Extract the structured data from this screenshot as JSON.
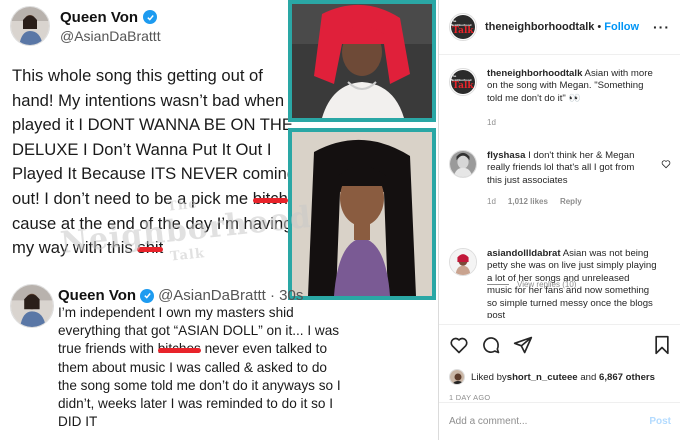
{
  "post_image": {
    "tweet1": {
      "name": "Queen Von",
      "handle": "@AsianDaBrattt",
      "text_a": "This whole song this getting out of hand! My intentions wasn’t bad when I played it I DONT WANNA BE ON THE DELUXE I Don’t Wanna Put It Out I Played It Because ITS NEVER coming out! I don’t need to be a pick me ",
      "censored_1": "bitch",
      "text_b": " cause at the end of the day I’m having my way with this ",
      "censored_2": "shit"
    },
    "watermark": {
      "small": "The",
      "big": "Neighborhood",
      "sub": "Talk"
    },
    "tweet2": {
      "name": "Queen Von",
      "handle_time": "@AsianDaBrattt · 30s",
      "text_a": "I’m independent I own my masters shid everything that got “ASIAN DOLL” on it... I was true friends with ",
      "censored": "bitches",
      "text_b": " never even talked to them about music I was called & asked to do the song some told me don’t do it anyways so I didn’t, weeks later I was reminded to do it so I DID IT"
    }
  },
  "sidebar": {
    "header": {
      "username": "theneighborhoodtalk",
      "separator": "•",
      "follow_label": "Follow",
      "more_label": "···",
      "logo_text_top": "The Neighborhood",
      "logo_text_bottom": "Talk"
    },
    "caption": {
      "username": "theneighborhoodtalk",
      "text": "Asian with more on the song with Megan. \"Something told me don't do it\" 👀",
      "time": "1d"
    },
    "comments": [
      {
        "username": "flyshasa",
        "text": "I don't think her & Megan really friends lol that's all I got from this just associates",
        "time": "1d",
        "likes": "1,012 likes",
        "reply_label": "Reply"
      },
      {
        "username": "asiandollldabrat",
        "text": "Asian was not being petty she was on live just simply playing a lot of her songs and unreleased music for her fans and now something so simple turned messy once the blogs post"
      }
    ],
    "view_replies": "View replies (10)",
    "likes": {
      "prefix": "Liked by ",
      "user": "short_n_cuteee",
      "middle": " and ",
      "others": "6,867 others"
    },
    "time_ago": "1 DAY AGO",
    "comment_input": {
      "placeholder": "Add a comment...",
      "post_label": "Post"
    }
  },
  "colors": {
    "accent_blue": "#0095f6",
    "frame_teal": "#2aa7a5",
    "censor_red": "#e8232a",
    "muted_text": "#8e8e8e"
  }
}
